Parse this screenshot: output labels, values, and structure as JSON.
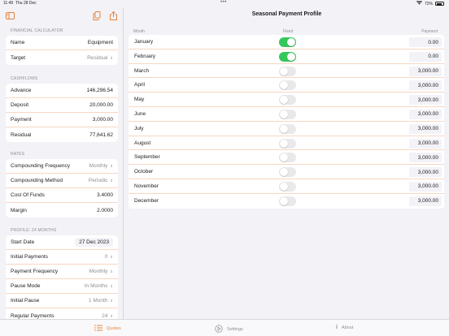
{
  "status_bar": {
    "time": "11:49",
    "date": "Thu 28 Dec",
    "battery": "72%"
  },
  "colors": {
    "accent": "#e8823a",
    "toggle_on": "#34c759",
    "separator": "#f7d7c2"
  },
  "left": {
    "financial": {
      "header": "FINANCIAL CALCULATOR",
      "name_label": "Name",
      "name_value": "Equipment",
      "target_label": "Target",
      "target_value": "Residual"
    },
    "cashflows": {
      "header": "CASHFLOWS",
      "rows": [
        {
          "label": "Advance",
          "value": "146,296.54"
        },
        {
          "label": "Deposit",
          "value": "20,000.00"
        },
        {
          "label": "Payment",
          "value": "3,000.00"
        },
        {
          "label": "Residual",
          "value": "77,641.62"
        }
      ]
    },
    "rates": {
      "header": "RATES",
      "comp_freq_label": "Compounding Frequency",
      "comp_freq_value": "Monthly",
      "comp_method_label": "Compounding Method",
      "comp_method_value": "Periodic",
      "cost_label": "Cost Of Funds",
      "cost_value": "3.4000",
      "margin_label": "Margin",
      "margin_value": "2.0000"
    },
    "profile": {
      "header": "PROFILE: 24 MONTHS",
      "start_label": "Start Date",
      "start_value": "27 Dec 2023",
      "initial_label": "Initial Payments",
      "initial_value": "0",
      "freq_label": "Payment Frequency",
      "freq_value": "Monthly",
      "pause_label": "Pause Mode",
      "pause_value": "In Months",
      "init_pause_label": "Initial Pause",
      "init_pause_value": "1 Month",
      "regular_label": "Regular Payments",
      "regular_value": "24"
    }
  },
  "main": {
    "title": "Seasonal Payment Profile",
    "col_month": "Month",
    "col_fixed": "Fixed",
    "col_payment": "Payment",
    "months": [
      {
        "month": "January",
        "fixed": true,
        "payment": "0.00"
      },
      {
        "month": "February",
        "fixed": true,
        "payment": "0.00"
      },
      {
        "month": "March",
        "fixed": false,
        "payment": "3,000.00"
      },
      {
        "month": "April",
        "fixed": false,
        "payment": "3,000.00"
      },
      {
        "month": "May",
        "fixed": false,
        "payment": "3,000.00"
      },
      {
        "month": "June",
        "fixed": false,
        "payment": "3,000.00"
      },
      {
        "month": "July",
        "fixed": false,
        "payment": "3,000.00"
      },
      {
        "month": "August",
        "fixed": false,
        "payment": "3,000.00"
      },
      {
        "month": "September",
        "fixed": false,
        "payment": "3,000.00"
      },
      {
        "month": "October",
        "fixed": false,
        "payment": "3,000.00"
      },
      {
        "month": "November",
        "fixed": false,
        "payment": "3,000.00"
      },
      {
        "month": "December",
        "fixed": false,
        "payment": "3,000.00"
      }
    ]
  },
  "tabs": [
    {
      "label": "Quotes",
      "icon": "list-icon",
      "active": true
    },
    {
      "label": "Settings",
      "icon": "gear-icon",
      "active": false
    },
    {
      "label": "About",
      "icon": "info-icon",
      "active": false
    }
  ]
}
